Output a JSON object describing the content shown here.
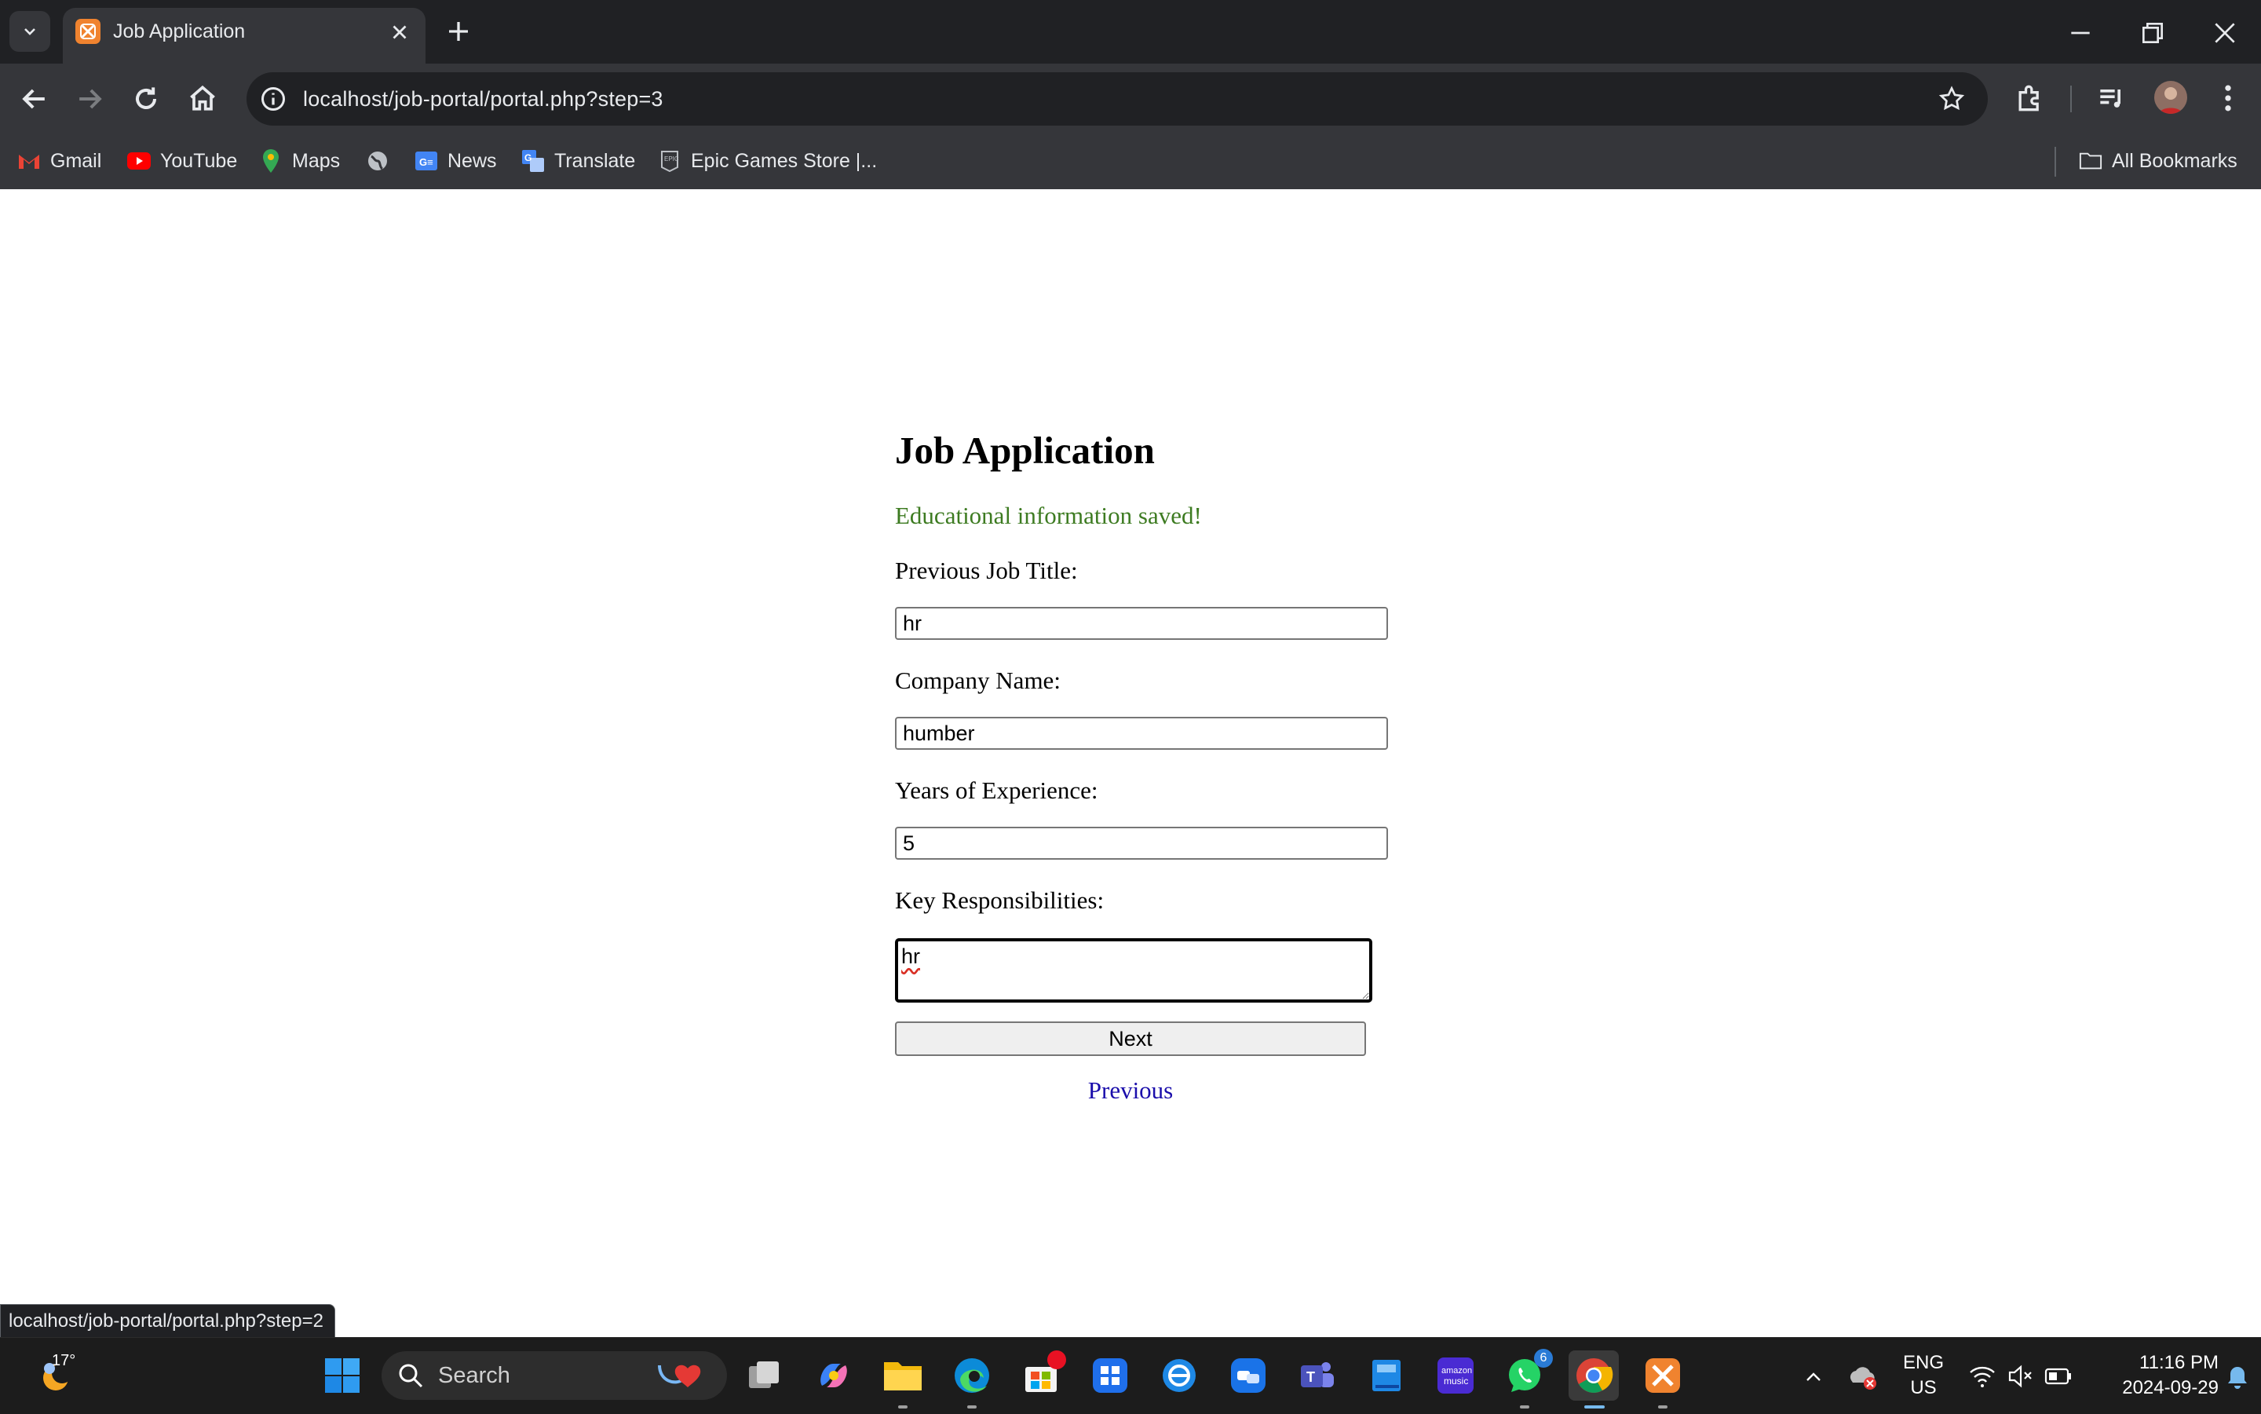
{
  "browser": {
    "tab": {
      "title": "Job Application"
    },
    "address": {
      "url": "localhost/job-portal/portal.php?step=3"
    },
    "bookmarks": [
      {
        "label": "Gmail",
        "icon": "gmail-icon"
      },
      {
        "label": "YouTube",
        "icon": "youtube-icon"
      },
      {
        "label": "Maps",
        "icon": "maps-icon"
      },
      {
        "label": "",
        "icon": "globe-icon"
      },
      {
        "label": "News",
        "icon": "news-icon"
      },
      {
        "label": "Translate",
        "icon": "translate-icon"
      },
      {
        "label": "Epic Games Store |...",
        "icon": "epic-games-icon"
      }
    ],
    "all_bookmarks": "All Bookmarks"
  },
  "page": {
    "heading": "Job Application",
    "success_message": "Educational information saved!",
    "fields": {
      "job_title": {
        "label": "Previous Job Title:",
        "value": "hr"
      },
      "company": {
        "label": "Company Name:",
        "value": "humber"
      },
      "experience": {
        "label": "Years of Experience:",
        "value": "5"
      },
      "responsibilities": {
        "label": "Key Responsibilities:",
        "value": "hr"
      }
    },
    "next_label": "Next",
    "previous_label": "Previous"
  },
  "status_bar": {
    "link_preview": "localhost/job-portal/portal.php?step=2"
  },
  "taskbar": {
    "weather": "17°",
    "search_placeholder": "Search",
    "whatsapp_badge": "6",
    "language": "ENG",
    "region": "US",
    "time": "11:16 PM",
    "date": "2024-09-29"
  },
  "colors": {
    "success": "#3d7b21",
    "link": "#1a0dab",
    "chrome_dark": "#202124",
    "chrome_toolbar": "#35363a"
  }
}
